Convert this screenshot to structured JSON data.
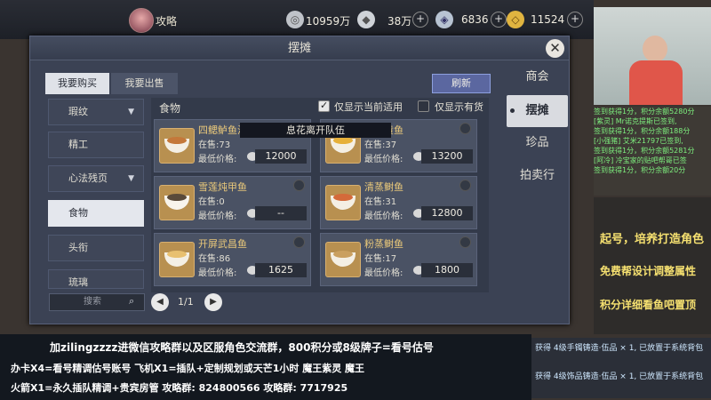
{
  "topbar": {
    "gonglue_label": "攻略",
    "silver": "10959万",
    "ingot": "38万",
    "gems": "6836",
    "gold": "11524"
  },
  "dialog": {
    "title": "摆摊",
    "close": "✕",
    "side_tabs": [
      "商会",
      "摆摊",
      "珍品",
      "拍卖行"
    ],
    "top_tabs": [
      "我要购买",
      "我要出售"
    ],
    "refresh": "刷新",
    "check_current": "仅显示当前适用",
    "check_stock": "仅显示有货",
    "category_label": "食物",
    "categories": [
      "瑕纹",
      "精工",
      "心法残页",
      "食物",
      "头衔",
      "琉璃"
    ],
    "search_placeholder": "搜索",
    "page": "1/1",
    "tooltip": "息花离开队伍",
    "items": [
      {
        "name": "四鳃鲈鱼汤",
        "sale": "在售:73",
        "price_label": "最低价格:",
        "price": "12000"
      },
      {
        "name": "火汤黄鱼",
        "sale": "在售:37",
        "price_label": "最低价格:",
        "price": "13200"
      },
      {
        "name": "雪莲炖甲鱼",
        "sale": "在售:0",
        "price_label": "最低价格:",
        "price": "--"
      },
      {
        "name": "清蒸鲥鱼",
        "sale": "在售:31",
        "price_label": "最低价格:",
        "price": "12800"
      },
      {
        "name": "开屏武昌鱼",
        "sale": "在售:86",
        "price_label": "最低价格:",
        "price": "1625"
      },
      {
        "name": "粉蒸鲥鱼",
        "sale": "在售:17",
        "price_label": "最低价格:",
        "price": "1800"
      }
    ]
  },
  "stream": {
    "chat": [
      "签到获得1分，积分余额5280分",
      "[紫灵] Mr诺克提斯已签到,",
      "签到获得1分，积分余额188分",
      "[小强猪] 艾米21797已签到,",
      "签到获得1分，积分余额5281分",
      "[阿冷] 冷宝家的贴吧帮哥已签",
      "签到获得1分，积分余额20分"
    ],
    "promo1": "起号，培养打造角色",
    "promo2": "免费帮设计调整属性",
    "promo3": "积分详细看鱼吧置顶",
    "ticker1": "加zilingzzzz进微信攻略群以及区服角色交流群，800积分或8级牌子=看号估号",
    "ticker2": "办卡X4=看号精调估号账号   飞机X1=插队+定制规划或天芒1小时   魔王紫灵   魔王",
    "ticker3": "火箭X1=永久插队精调+贵宾房管   攻略群: 824800566   攻略群: 7717925",
    "notice1": "获得 4级手镯铸造·伍品 × 1, 已放置于系统背包",
    "notice2": "获得 4级饰品铸造·伍品 × 1, 已放置于系统背包"
  },
  "colors": {
    "accent": "#e9c87a",
    "panel": "#3b4254",
    "active_tab": "#dfe2e8",
    "refresh": "#5b67a0"
  }
}
